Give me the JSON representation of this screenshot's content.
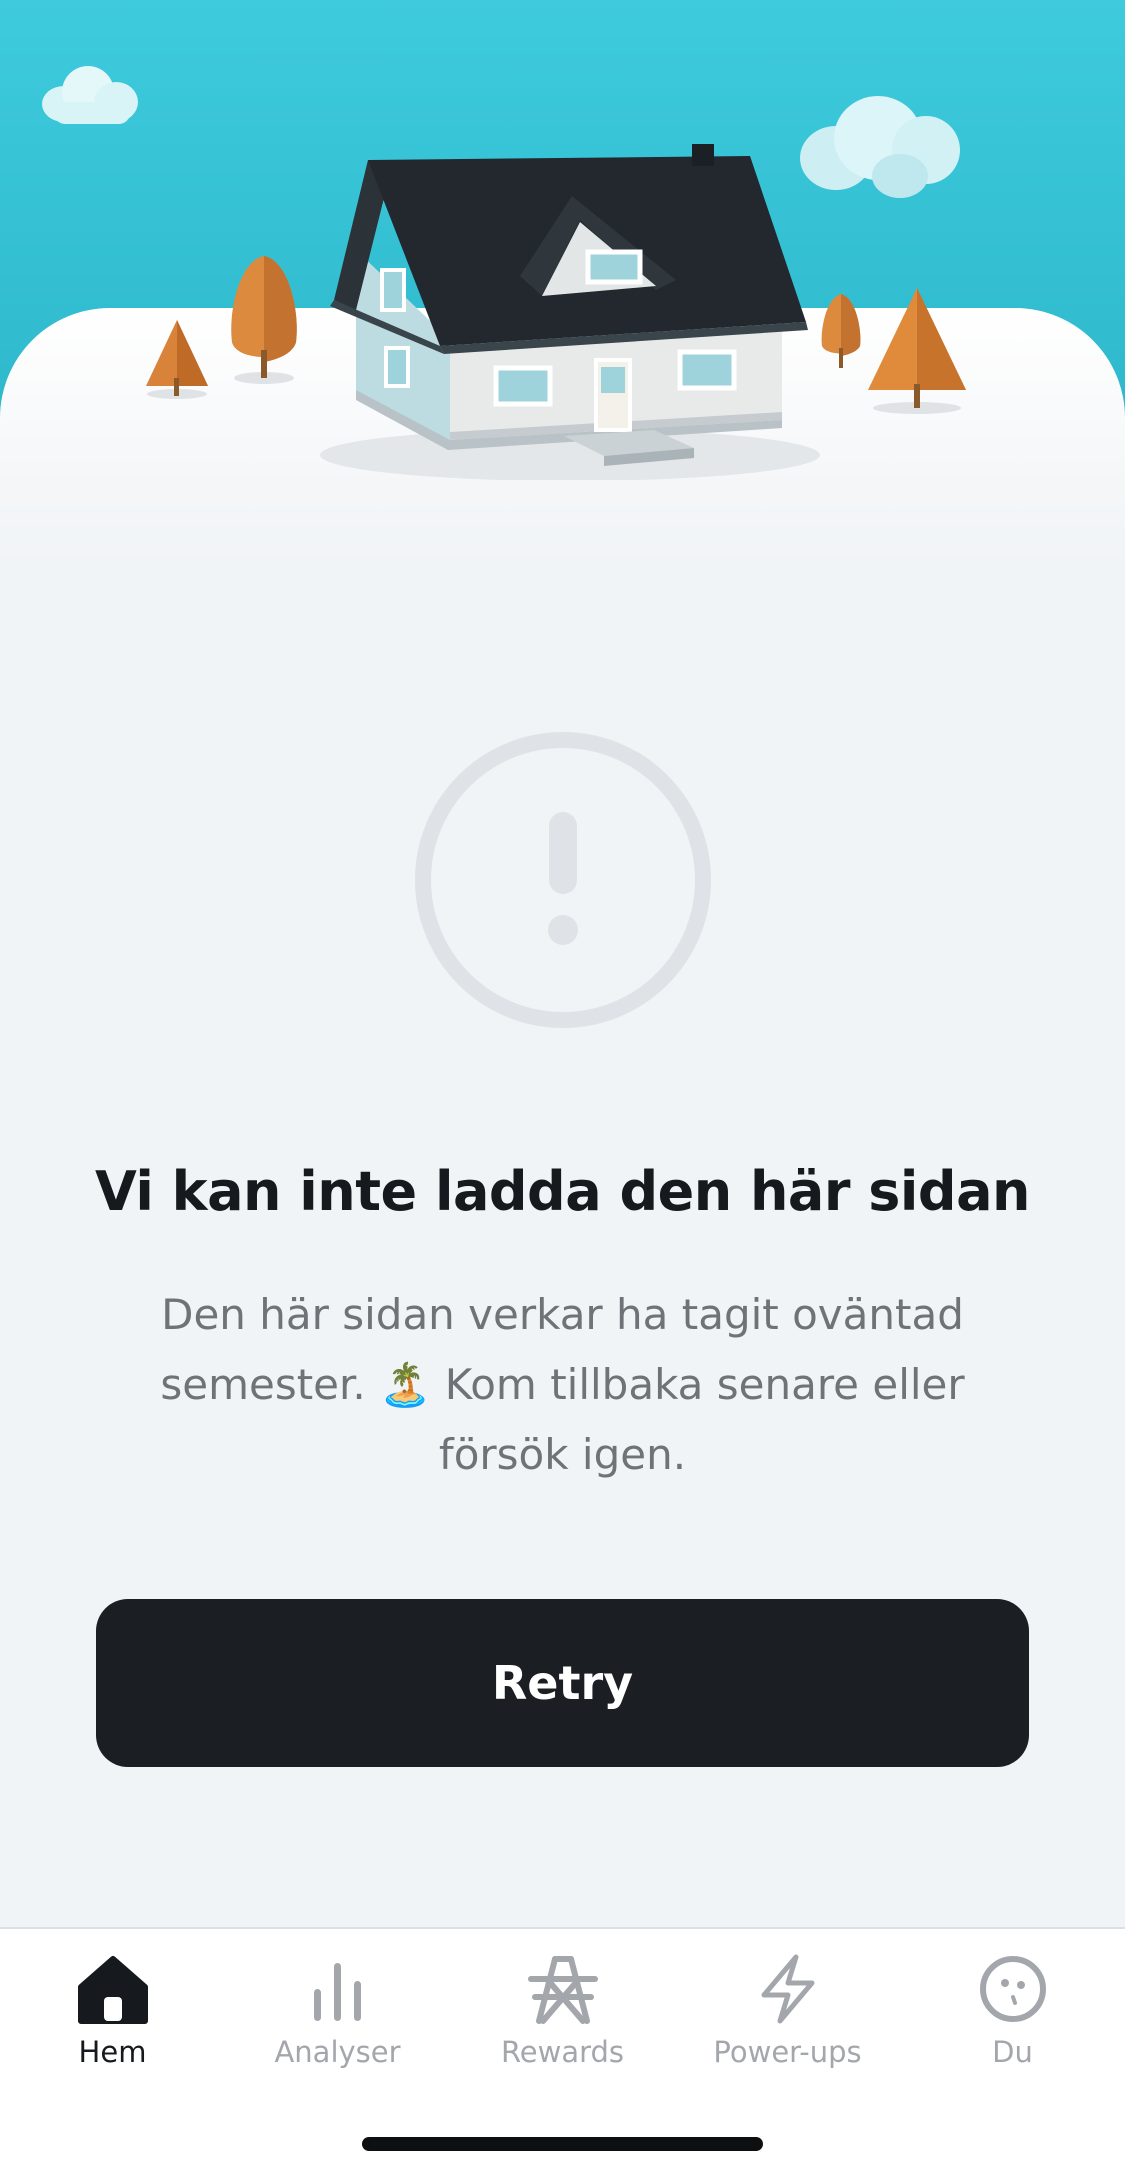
{
  "error": {
    "title": "Vi kan inte ladda den här sidan",
    "message": "Den här sidan verkar ha tagit oväntad semester. 🏝️ Kom tillbaka senare eller försök igen.",
    "retry_label": "Retry",
    "icon": "exclamation-circle-icon"
  },
  "tabs": [
    {
      "label": "Hem",
      "icon": "home-icon",
      "active": true
    },
    {
      "label": "Analyser",
      "icon": "bar-chart-icon",
      "active": false
    },
    {
      "label": "Rewards",
      "icon": "power-pylon-icon",
      "active": false
    },
    {
      "label": "Power-ups",
      "icon": "lightning-icon",
      "active": false
    },
    {
      "label": "Du",
      "icon": "face-icon",
      "active": false
    }
  ],
  "colors": {
    "sky": "#3ecbdd",
    "background": "#f1f4f7",
    "button": "#1b1e22",
    "active_tab": "#16191d",
    "inactive_tab": "#a3a7ac"
  }
}
